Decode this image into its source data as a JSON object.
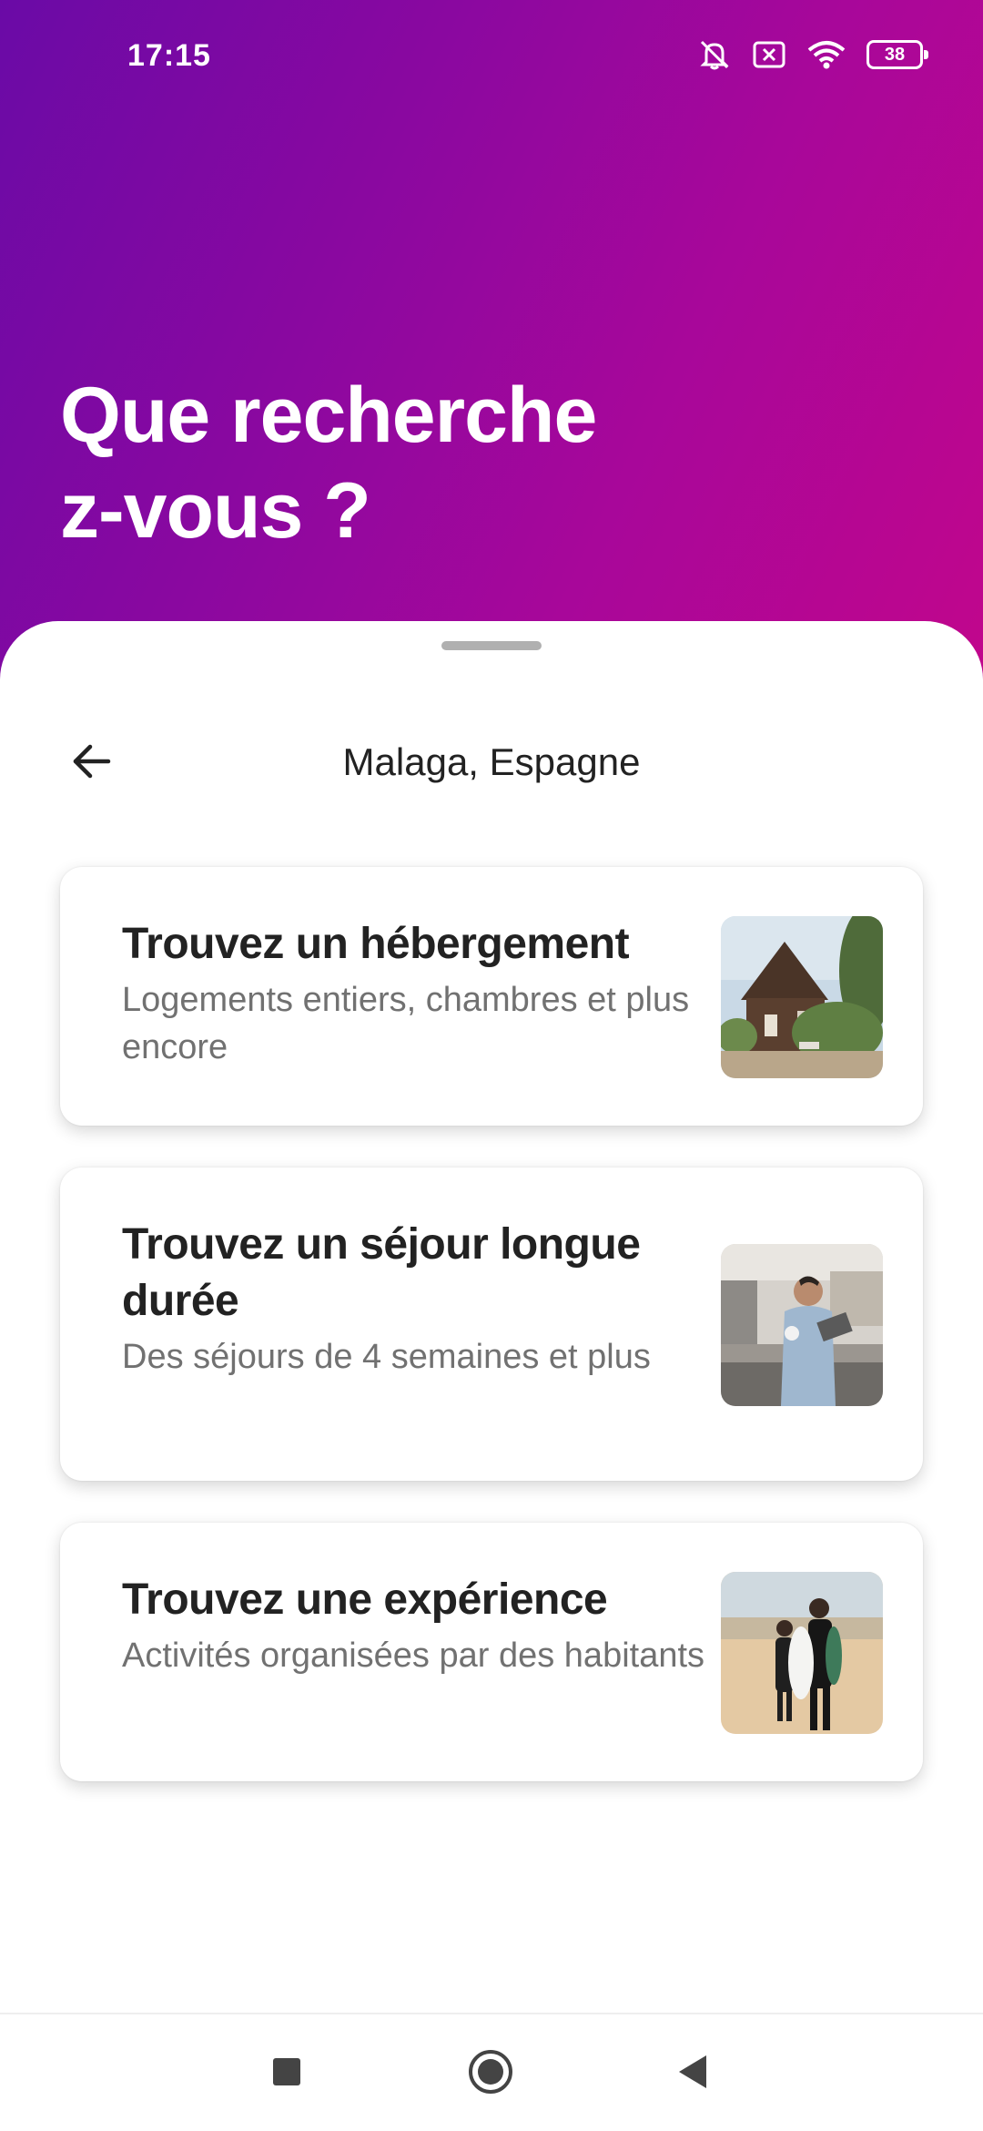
{
  "status_bar": {
    "time": "17:15",
    "battery_level": "38",
    "icons": [
      "notifications-muted-icon",
      "sim-no-signal-icon",
      "wifi-icon",
      "battery-icon"
    ]
  },
  "hero": {
    "title": "Que recherche\nz-vous ?"
  },
  "sheet": {
    "location": "Malaga, Espagne",
    "back_icon": "arrow-left-icon"
  },
  "cards": [
    {
      "title": "Trouvez un hébergement",
      "description": "Logements entiers, chambres et plus encore",
      "thumbnail": "cottage-house-photo"
    },
    {
      "title": "Trouvez un séjour longue durée",
      "description": "Des séjours de 4 semaines et plus",
      "thumbnail": "man-in-kitchen-photo"
    },
    {
      "title": "Trouvez une expérience",
      "description": "Activités organisées par des habitants",
      "thumbnail": "surfers-on-beach-photo"
    }
  ],
  "nav_bar": {
    "buttons": [
      "recent-apps-icon",
      "home-icon",
      "back-icon"
    ]
  },
  "colors": {
    "hero_gradient_start": "#6a0aa6",
    "hero_gradient_end": "#c1068c",
    "title_text": "#222222",
    "secondary_text": "#717171"
  }
}
